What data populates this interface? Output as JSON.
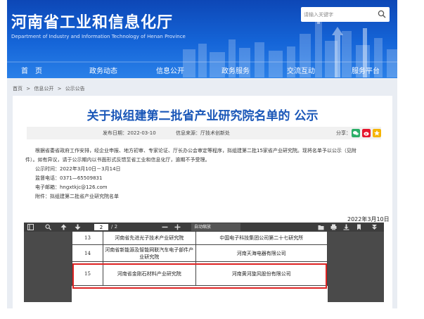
{
  "header": {
    "title": "河南省工业和信息化厅",
    "subtitle": "Department of Industry and Information Technology of Henan Province",
    "search_placeholder": "请输入关键字"
  },
  "nav": {
    "items": [
      "首　页",
      "政务动态",
      "信息公开",
      "政务服务",
      "交流互动",
      "服务平台"
    ]
  },
  "breadcrumb": [
    "首页",
    ">",
    "信息公开",
    ">",
    "公示公告"
  ],
  "article": {
    "title": "关于拟组建第二批省产业研究院名单的 公示",
    "pub_date": "发布日期：2022-03-10",
    "source": "信息来源：厅技术创新处",
    "share_label": "分享：",
    "body_lines": [
      "根据省委省政府工作安排，经企业申报、地方初审、专家论证、厅长办公会审定等程序，拟组建第二批15家省产业研究院。现将名单予以公示（见附",
      "件）。如有异议，请于公示期内以书面形式反馈至省工业和信息化厅，逾期不予受理。",
      "公示时间：2022年3月10日－3月14日",
      "监督电话：0371—65509831",
      "电子邮箱：hngxtkjc@126.com",
      "附件：拟组建第二批省产业研究院名单"
    ],
    "date": "2022年3月10日"
  },
  "pdf": {
    "page_current": "2",
    "page_total": "/ 2",
    "zoom": "自动缩放",
    "rows": [
      {
        "no": "13",
        "institute": "河南省先进光子技术产业研究院",
        "company": "中国电子科技集团公司第二十七研究所"
      },
      {
        "no": "14",
        "institute": "河南省新能源及智能网联汽车电子部件产业研究院",
        "company": "河南天海电器有限公司"
      },
      {
        "no": "15",
        "institute": "河南省金刚石材料产业研究院",
        "company": "河南黄河旋风股份有限公司"
      }
    ]
  },
  "colors": {
    "header_blue": "#1565d8",
    "title_blue": "#1a57b8",
    "highlight_red": "#dd2222",
    "wechat_green": "#2aae67",
    "weibo_red": "#e6162d",
    "qzone_yellow": "#f5b400"
  }
}
